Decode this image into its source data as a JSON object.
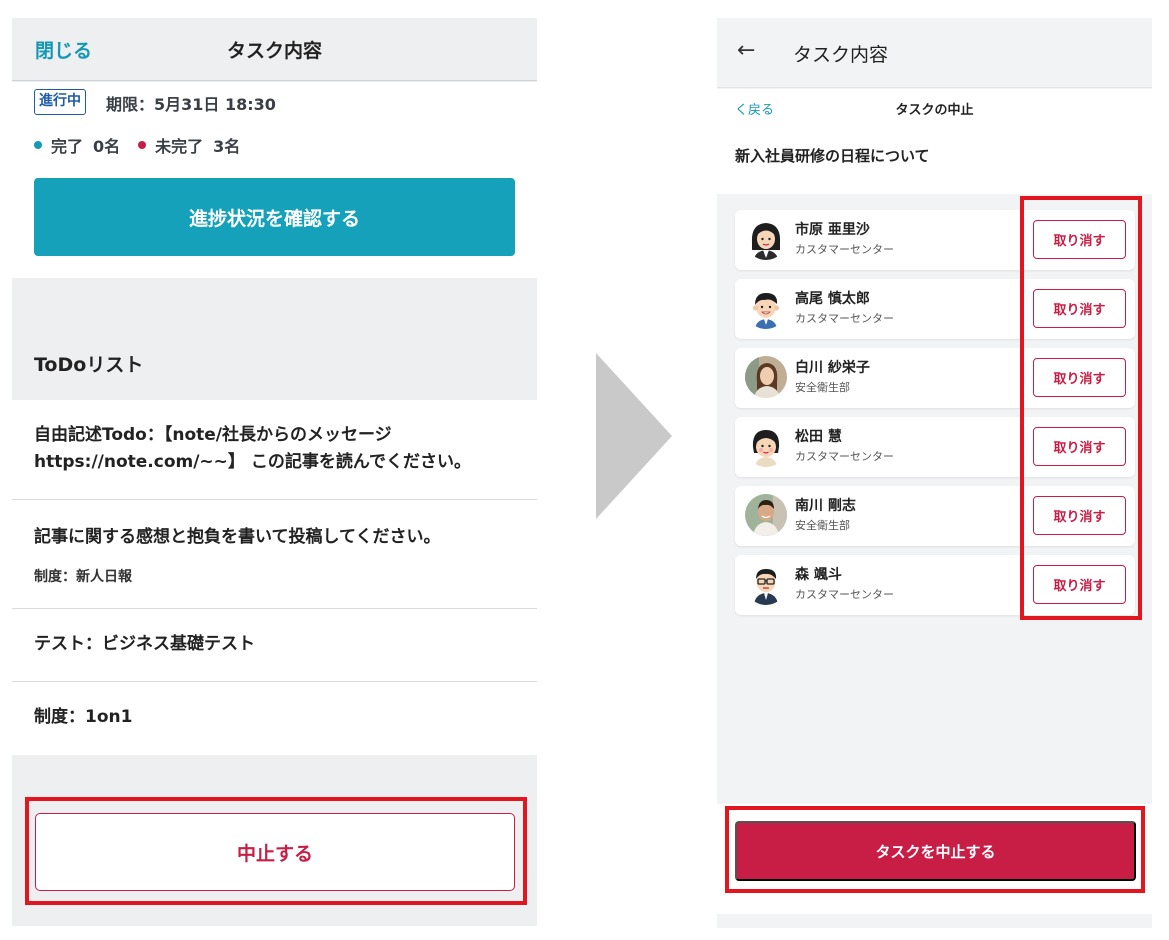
{
  "left": {
    "header": {
      "close": "閉じる",
      "title": "タスク内容"
    },
    "status": {
      "badge": "進行中",
      "deadline": "期限：5月31日 18:30",
      "done_label": "完了",
      "done_count": "0名",
      "undone_label": "未完了",
      "undone_count": "3名",
      "progress_button": "進捗状況を確認する"
    },
    "todo": {
      "title": "ToDoリスト",
      "items": [
        {
          "line1": "自由記述Todo：【note/社長からのメッセージ",
          "line2": "https://note.com/~~】 この記事を読んでください。"
        },
        {
          "line1": "記事に関する感想と抱負を書いて投稿してください。",
          "line2": "制度：新人日報"
        },
        {
          "line1": "テスト：ビジネス基礎テスト"
        },
        {
          "line1": "制度：1on1"
        }
      ]
    },
    "stop_button": "中止する"
  },
  "right": {
    "header": {
      "back_arrow": "←",
      "title": "タスク内容"
    },
    "sub": {
      "back": "く戻る",
      "title": "タスクの中止",
      "task_name": "新入社員研修の日程について"
    },
    "members": [
      {
        "name": "市原 亜里沙",
        "dept": "カスタマーセンター",
        "avatar": "woman-bob-avatar",
        "action": "取り消す"
      },
      {
        "name": "高尾 慎太郎",
        "dept": "カスタマーセンター",
        "avatar": "man-smile-avatar",
        "action": "取り消す"
      },
      {
        "name": "白川 紗栄子",
        "dept": "安全衛生部",
        "avatar": "woman-photo-avatar",
        "action": "取り消す"
      },
      {
        "name": "松田 慧",
        "dept": "カスタマーセンター",
        "avatar": "woman-short-avatar",
        "action": "取り消す"
      },
      {
        "name": "南川 剛志",
        "dept": "安全衛生部",
        "avatar": "man-photo-avatar",
        "action": "取り消す"
      },
      {
        "name": "森 颯斗",
        "dept": "カスタマーセンター",
        "avatar": "man-glasses-avatar",
        "action": "取り消す"
      }
    ],
    "stop_task_button": "タスクを中止する"
  },
  "colors": {
    "teal": "#14a1b9",
    "crimson": "#c81e45",
    "highlight": "#e3161f",
    "arrow": "#c9c9c9"
  }
}
